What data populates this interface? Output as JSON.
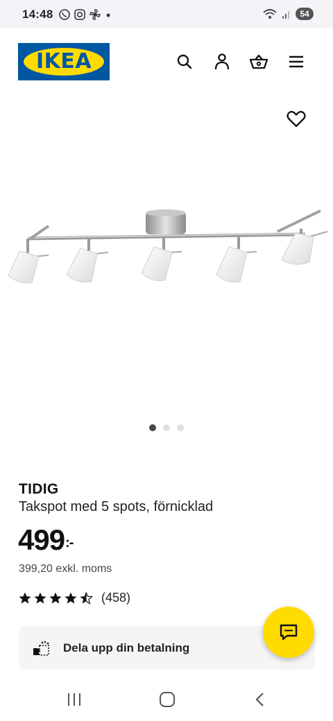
{
  "status_bar": {
    "time": "14:48",
    "battery": "54"
  },
  "header": {
    "logo_text": "IKEA",
    "icons": [
      "search-icon",
      "account-icon",
      "basket-icon",
      "menu-icon"
    ]
  },
  "gallery": {
    "image_count": 3,
    "active_index": 0
  },
  "product": {
    "name": "TIDIG",
    "description": "Takspot med 5 spots, förnicklad",
    "price": "499",
    "price_suffix": ":-",
    "price_ex_vat": "399,20 exkl. moms",
    "rating": 4.5,
    "rating_count": "(458)"
  },
  "payment": {
    "label": "Dela upp din betalning"
  },
  "colors": {
    "ikea_blue": "#0058a3",
    "ikea_yellow": "#ffdb00"
  }
}
